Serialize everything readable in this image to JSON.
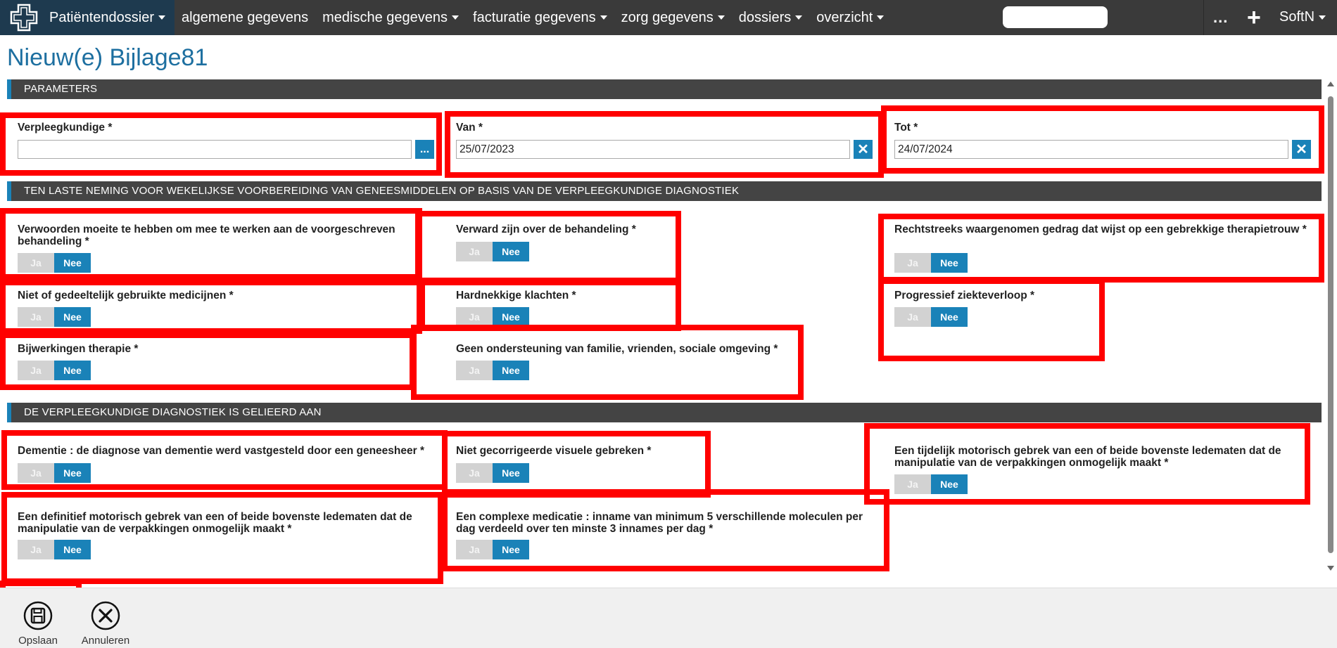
{
  "nav": {
    "brand_label": "Patiëntendossier",
    "menu": [
      {
        "label": "algemene gegevens"
      },
      {
        "label": "medische gegevens"
      },
      {
        "label": "facturatie gegevens"
      },
      {
        "label": "zorg gegevens"
      },
      {
        "label": "dossiers"
      },
      {
        "label": "overzicht"
      }
    ],
    "more": "...",
    "plus": "+",
    "user": "SoftN"
  },
  "page": {
    "title": "Nieuw(e) Bijlage81"
  },
  "sections": {
    "parameters": "PARAMETERS",
    "ten_laste": "TEN LASTE NEMING VOOR WEKELIJKSE VOORBEREIDING VAN GENEESMIDDELEN OP BASIS VAN DE VERPLEEGKUNDIGE DIAGNOSTIEK",
    "gelieerd": "DE VERPLEEGKUNDIGE DIAGNOSTIEK IS GELIEERD AAN"
  },
  "params": {
    "verpleegkundige_label": "Verpleegkundige *",
    "verpleegkundige_value": "",
    "browse_label": "...",
    "van_label": "Van *",
    "van_value": "25/07/2023",
    "tot_label": "Tot *",
    "tot_value": "24/07/2024",
    "clear_symbol": "✕"
  },
  "toggle": {
    "ja": "Ja",
    "nee": "Nee",
    "selected": "Nee"
  },
  "questions_a": {
    "q1": "Verwoorden moeite te hebben om mee te werken aan de voorgeschreven behandeling *",
    "q2": "Verward zijn over de behandeling *",
    "q3": "Rechtstreeks waargenomen gedrag dat wijst op een gebrekkige therapietrouw *",
    "q4": "Niet of gedeeltelijk gebruikte medicijnen *",
    "q5": "Hardnekkige klachten *",
    "q6": "Progressief ziekteverloop *",
    "q7": "Bijwerkingen therapie *",
    "q8": "Geen ondersteuning van familie, vrienden, sociale omgeving *"
  },
  "questions_b": {
    "q1": "Dementie : de diagnose van dementie werd vastgesteld door een geneesheer *",
    "q2": "Niet gecorrigeerde visuele gebreken *",
    "q3": "Een tijdelijk motorisch gebrek van een of beide bovenste ledematen dat de manipulatie van de verpakkingen onmogelijk maakt *",
    "q4": "Een definitief motorisch gebrek van een of beide bovenste ledematen dat de manipulatie van de verpakkingen onmogelijk maakt *",
    "q5": "Een complexe medicatie : inname van minimum 5 verschillende moleculen per dag verdeeld over ten minste 3 innames per dag *"
  },
  "footer": {
    "save_label": "Opslaan",
    "cancel_label": "Annuleren"
  },
  "colors": {
    "accent": "#1a82b8",
    "title": "#1d6fa0",
    "nav_bg": "#3a3a3a",
    "brand_bg": "#1e3a4f",
    "section_bg": "#444444",
    "annotation": "#ff0000"
  }
}
